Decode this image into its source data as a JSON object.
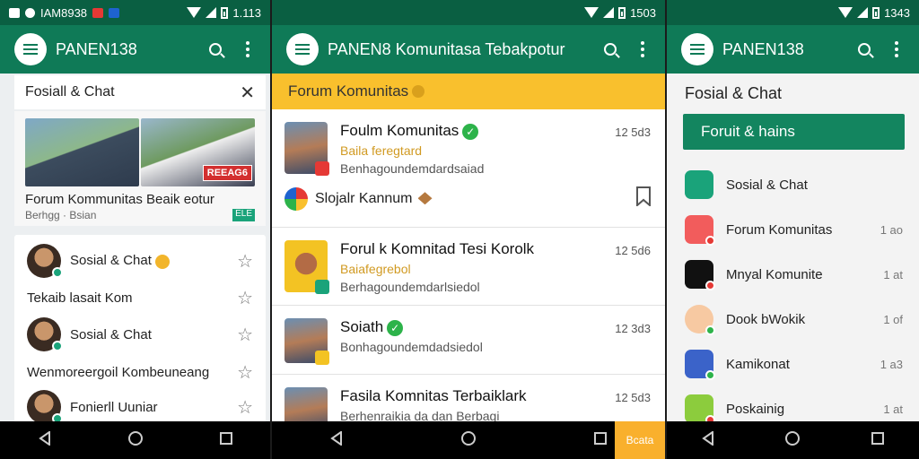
{
  "screens": [
    {
      "status": {
        "left_text": "IAM8938",
        "time": "1.113"
      },
      "appbar_title": "PANEN138",
      "search": {
        "value": "Fosiall & Chat"
      },
      "featured": {
        "photo_badge": "REEAG6",
        "title": "Forum Kommunitas Beaik eotur",
        "sub": "Berhgg  ·  Bsian",
        "tag": "ELE"
      },
      "list": [
        {
          "label": "Sosial & Chat",
          "avatar": true,
          "emoji": true
        },
        {
          "label": "Tekaib lasait Kom",
          "avatar": false
        },
        {
          "label": "Sosial & Chat",
          "avatar": true
        },
        {
          "label": "Wenmoreergoil Kombeuneang",
          "avatar": false
        },
        {
          "label": "Fonierll Uuniar",
          "avatar": true
        }
      ]
    },
    {
      "status": {
        "time": "1503"
      },
      "appbar_title": "PANEN8 Komunitasa Tebakpotur",
      "banner": "Forum Komunitas",
      "items": [
        {
          "title": "Foulm Komunitas",
          "sub1": "Baila feregtard",
          "sub2": "Benhagoundemdardsaiad",
          "time": "12 5d3",
          "verified": true
        },
        {
          "title": "Forul k Komnitad Tesi Korolk",
          "sub1": "Baiafegrebol",
          "sub2": "Berhagoundemdarlsiedol",
          "time": "12 5d6",
          "verified": false
        },
        {
          "title": "Soiath",
          "sub1": "",
          "sub2": "Bonhagoundemdadsiedol",
          "time": "12 3d3",
          "verified": true
        },
        {
          "title": "Fasila Komnitas Terbaiklark",
          "sub1": "",
          "sub2": "Berhenraikia da dan Berbagi",
          "time": "12 5d3",
          "verified": false
        }
      ],
      "mini": {
        "label": "Slojalr Kannum"
      },
      "cta": "Bcata"
    },
    {
      "status": {
        "time": "1343"
      },
      "appbar_title": "PANEN138",
      "heading": "Fosial & Chat",
      "button": "Foruit & hains",
      "apps": [
        {
          "label": "Sosial & Chat",
          "count": "",
          "color": "#1aa37a"
        },
        {
          "label": "Forum Komunitas",
          "count": "1 ao",
          "color": "#f25c5c"
        },
        {
          "label": "Mnyal Komunite",
          "count": "1 at",
          "color": "#111111"
        },
        {
          "label": "Dook bWokik",
          "count": "1 of",
          "color": "#f7c9a2"
        },
        {
          "label": "Kamikonat",
          "count": "1 a3",
          "color": "#3b63c9"
        },
        {
          "label": "Poskainig",
          "count": "1 at",
          "color": "#8ccc3d"
        }
      ]
    }
  ]
}
